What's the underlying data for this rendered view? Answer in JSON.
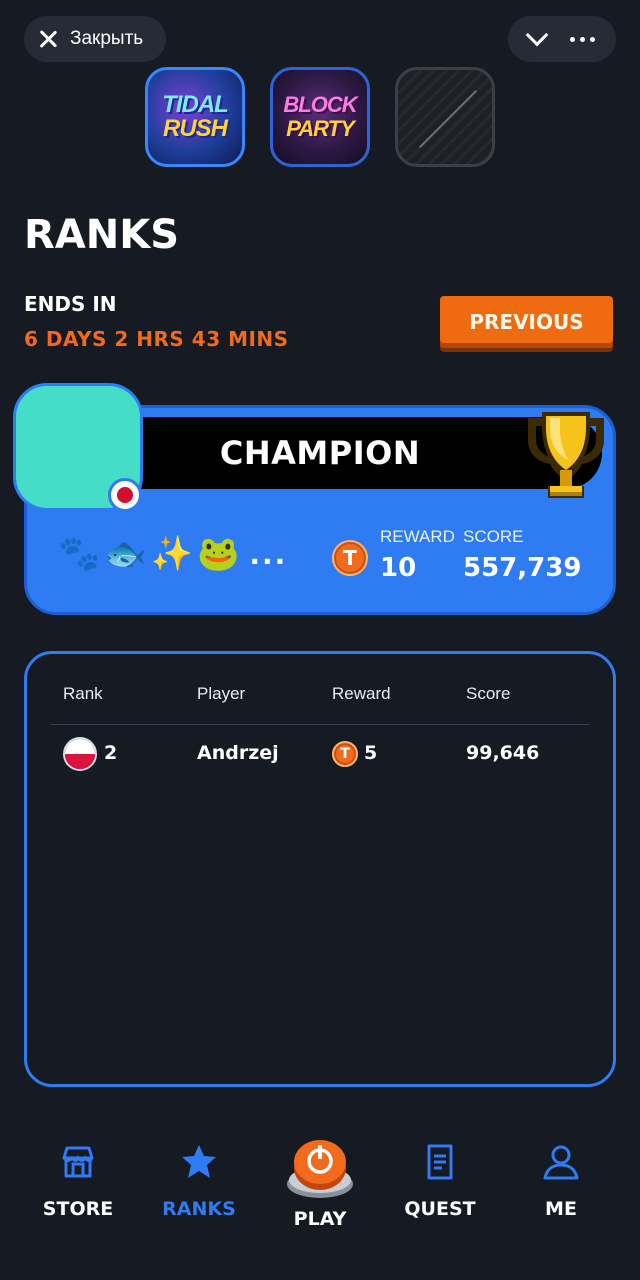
{
  "topbar": {
    "close_label": "Закрыть"
  },
  "games": [
    {
      "line1": "TIDAL",
      "line2": "RUSH"
    },
    {
      "line1": "BLOCK",
      "line2": "PARTY"
    },
    {
      "line1": "",
      "line2": ""
    }
  ],
  "header": {
    "title": "RANKS",
    "ends_label": "ENDS IN",
    "ends_time": "6 DAYS 2 HRS 43 MINS",
    "previous_label": "PREVIOUS"
  },
  "champion": {
    "banner": "CHAMPION",
    "emojis": "🐾🐟✨🐸",
    "emojis_more": "...",
    "coin_letter": "T",
    "reward_label": "REWARD",
    "reward_value": "10",
    "score_label": "SCORE",
    "score_value": "557,739"
  },
  "table": {
    "headers": {
      "rank": "Rank",
      "player": "Player",
      "reward": "Reward",
      "score": "Score"
    },
    "rows": [
      {
        "rank": "2",
        "player": "Andrzej",
        "coin_letter": "T",
        "reward": "5",
        "score": "99,646"
      }
    ]
  },
  "nav": {
    "store": "STORE",
    "ranks": "RANKS",
    "play": "PLAY",
    "quest": "QUEST",
    "me": "ME"
  },
  "colors": {
    "background": "#161a23",
    "accent_blue": "#2f7bf2",
    "accent_orange": "#f26a1b",
    "avatar": "#45dcc8"
  }
}
